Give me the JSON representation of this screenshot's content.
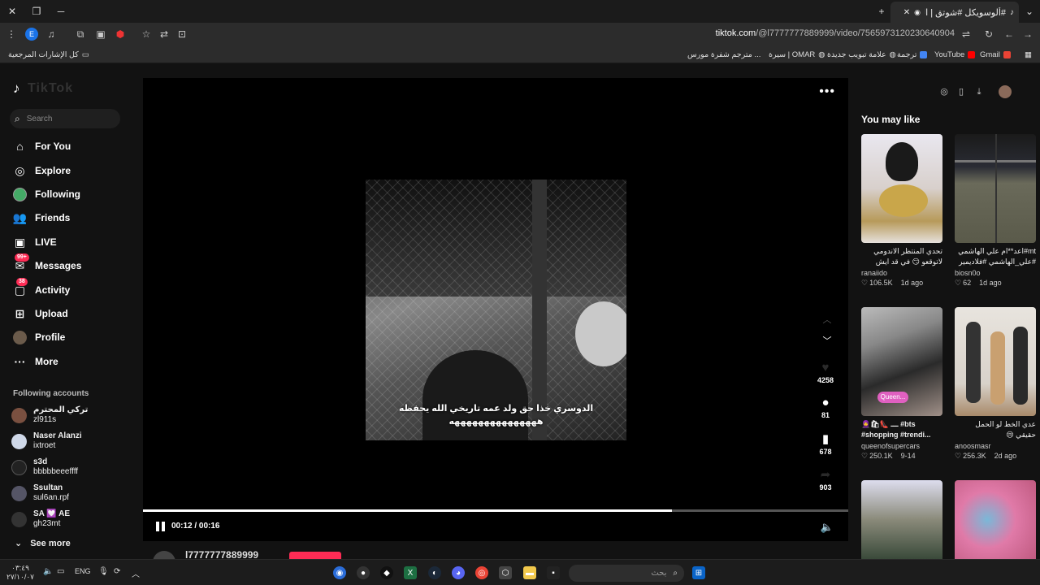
{
  "browser": {
    "tab_title": "#ألوسويكل #شوتق | الدوسر",
    "url_domain": "tiktok.com",
    "url_path": "/@l7777777889999/video/7565973120230640904",
    "bookmarks": [
      "كل الإشارات المرجعية",
      "Gmail",
      "YouTube",
      "ترجمة",
      "علامة تبويب جديدة",
      "سيرة | OMAR",
      "مترجم شفرة مورس ..."
    ]
  },
  "tiktok": {
    "logo_text": "TikTok",
    "search_placeholder": "Search",
    "nav": [
      {
        "label": "For You",
        "icon": "home-icon"
      },
      {
        "label": "Explore",
        "icon": "compass-icon"
      },
      {
        "label": "Following",
        "icon": "following-avatar-icon"
      },
      {
        "label": "Friends",
        "icon": "friends-icon"
      },
      {
        "label": "LIVE",
        "icon": "live-icon"
      },
      {
        "label": "Messages",
        "icon": "messages-icon",
        "badge": "99+"
      },
      {
        "label": "Activity",
        "icon": "activity-icon",
        "badge": "38"
      },
      {
        "label": "Upload",
        "icon": "upload-icon"
      },
      {
        "label": "Profile",
        "icon": "profile-avatar-icon"
      },
      {
        "label": "More",
        "icon": "more-dots-icon"
      }
    ],
    "following_title": "Following accounts",
    "accounts": [
      {
        "name": "تركي المحترم",
        "handle": "zl911s"
      },
      {
        "name": "Naser Alanzi",
        "handle": "ixtroet"
      },
      {
        "name": "s3d",
        "handle": "bbbbbeeeffff"
      },
      {
        "name": "Ssultan",
        "handle": "sul6an.rpf"
      },
      {
        "name": "SA 💟 AE",
        "handle": "gh23mt"
      }
    ],
    "see_more": "See more"
  },
  "video": {
    "caption_line1": "الدوسري خذا حق ولد عمه تاريخي الله يحفظه",
    "caption_line2": "هههههههههههههههه",
    "likes": "4258",
    "comments": "81",
    "saves": "678",
    "shares": "903",
    "time": "00:12 / 00:16",
    "progress": 0.75,
    "author": "l7777777889999"
  },
  "recommend": {
    "title": "You may like",
    "cards": [
      {
        "caption": "تحدي المنتظر الاندومي لاتوقعو 😏 في قد ايش اقدر اخلصهم",
        "author": "ranaiido",
        "likes": "106.5K",
        "age": "1d ago",
        "ltr": false
      },
      {
        "caption": "mt#اعد**ام علي الهاشمي #علي_الهاشمي #فلاديمير",
        "author": "biosn0o",
        "likes": "62",
        "age": "1d ago",
        "ltr": false
      },
      {
        "caption": "🧕🛍👠 ـــ #bts #shopping #trendi...",
        "author": "queenofsupercars",
        "likes": "250.1K",
        "age": "9-14",
        "ltr": true
      },
      {
        "caption": "عدي الخط لو الحمل حقيقي 😢",
        "author": "anoosmasr",
        "likes": "256.3K",
        "age": "2d ago",
        "ltr": false
      }
    ]
  },
  "taskbar": {
    "time": "٠٣:٤٩",
    "date": "٢٧/١٠/٠٧",
    "lang": "ENG",
    "search_placeholder": "بحث"
  },
  "colors": {
    "accent": "#fe2c55",
    "bg": "#121212"
  }
}
